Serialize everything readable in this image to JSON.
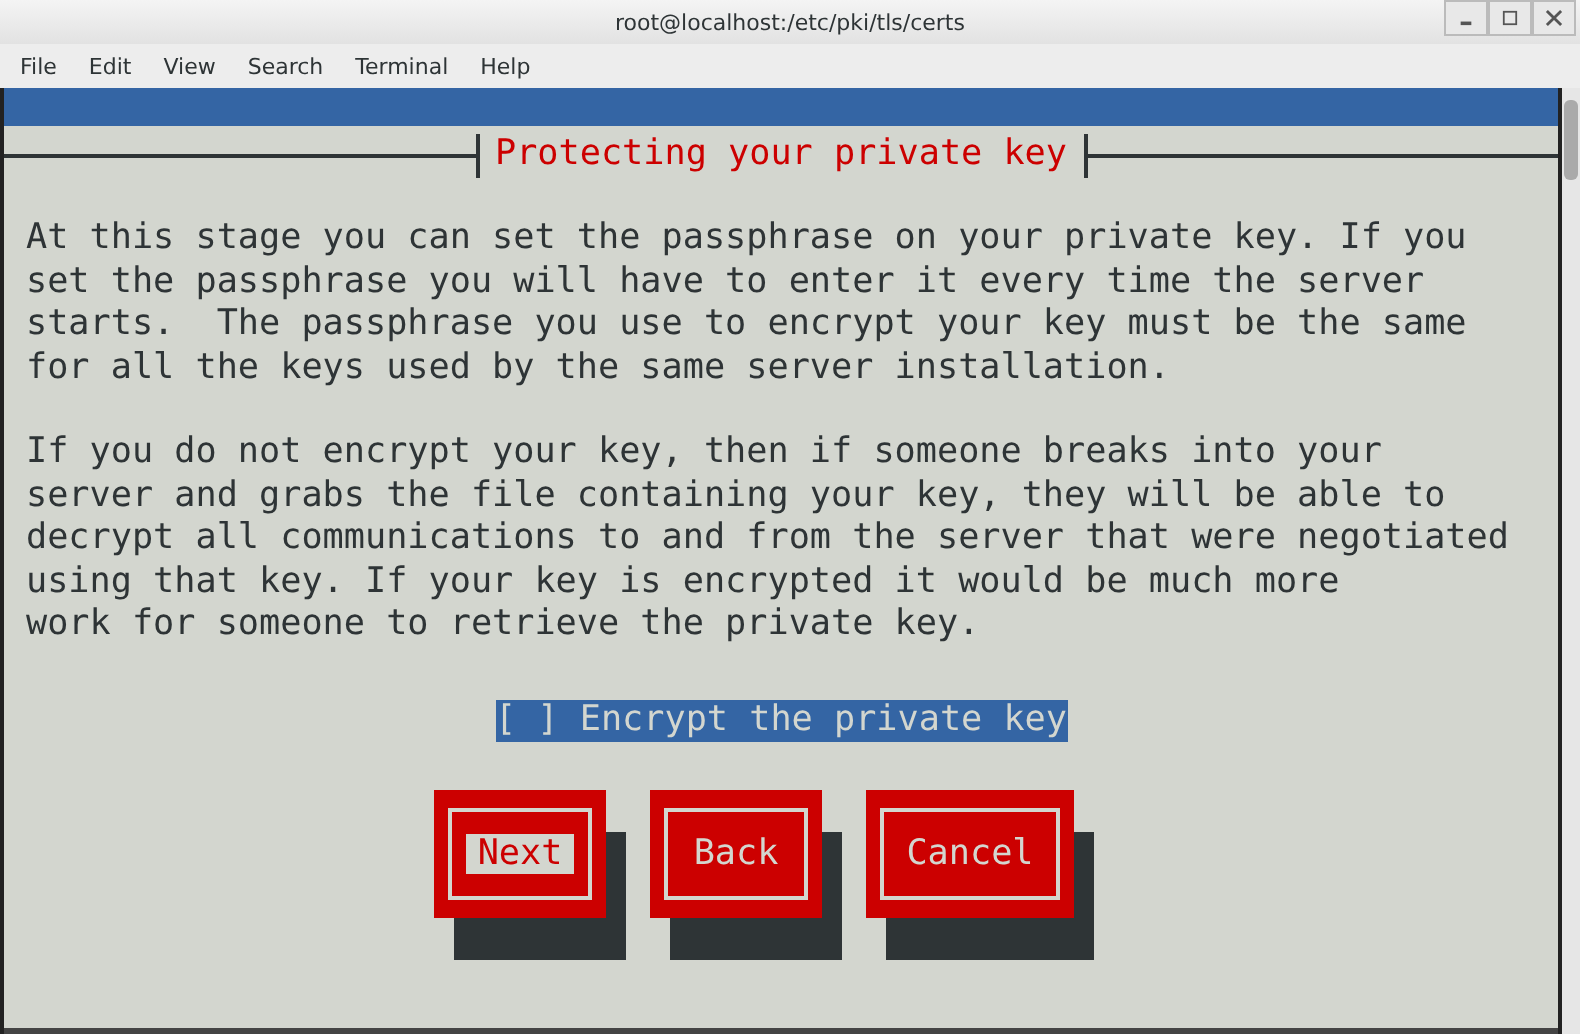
{
  "window": {
    "title": "root@localhost:/etc/pki/tls/certs"
  },
  "menu": [
    "File",
    "Edit",
    "View",
    "Search",
    "Terminal",
    "Help"
  ],
  "dialog": {
    "title": "Protecting your private key",
    "paragraphs": [
      "At this stage you can set the passphrase on your private key. If you\nset the passphrase you will have to enter it every time the server\nstarts.  The passphrase you use to encrypt your key must be the same\nfor all the keys used by the same server installation.",
      "If you do not encrypt your key, then if someone breaks into your\nserver and grabs the file containing your key, they will be able to\ndecrypt all communications to and from the server that were negotiated\nusing that key. If your key is encrypted it would be much more\nwork for someone to retrieve the private key."
    ],
    "checkbox": {
      "mark": "[ ]",
      "label": "Encrypt the private key",
      "checked": false,
      "selected": true
    },
    "buttons": [
      {
        "label": "Next",
        "selected": true
      },
      {
        "label": "Back",
        "selected": false
      },
      {
        "label": "Cancel",
        "selected": false
      }
    ]
  }
}
